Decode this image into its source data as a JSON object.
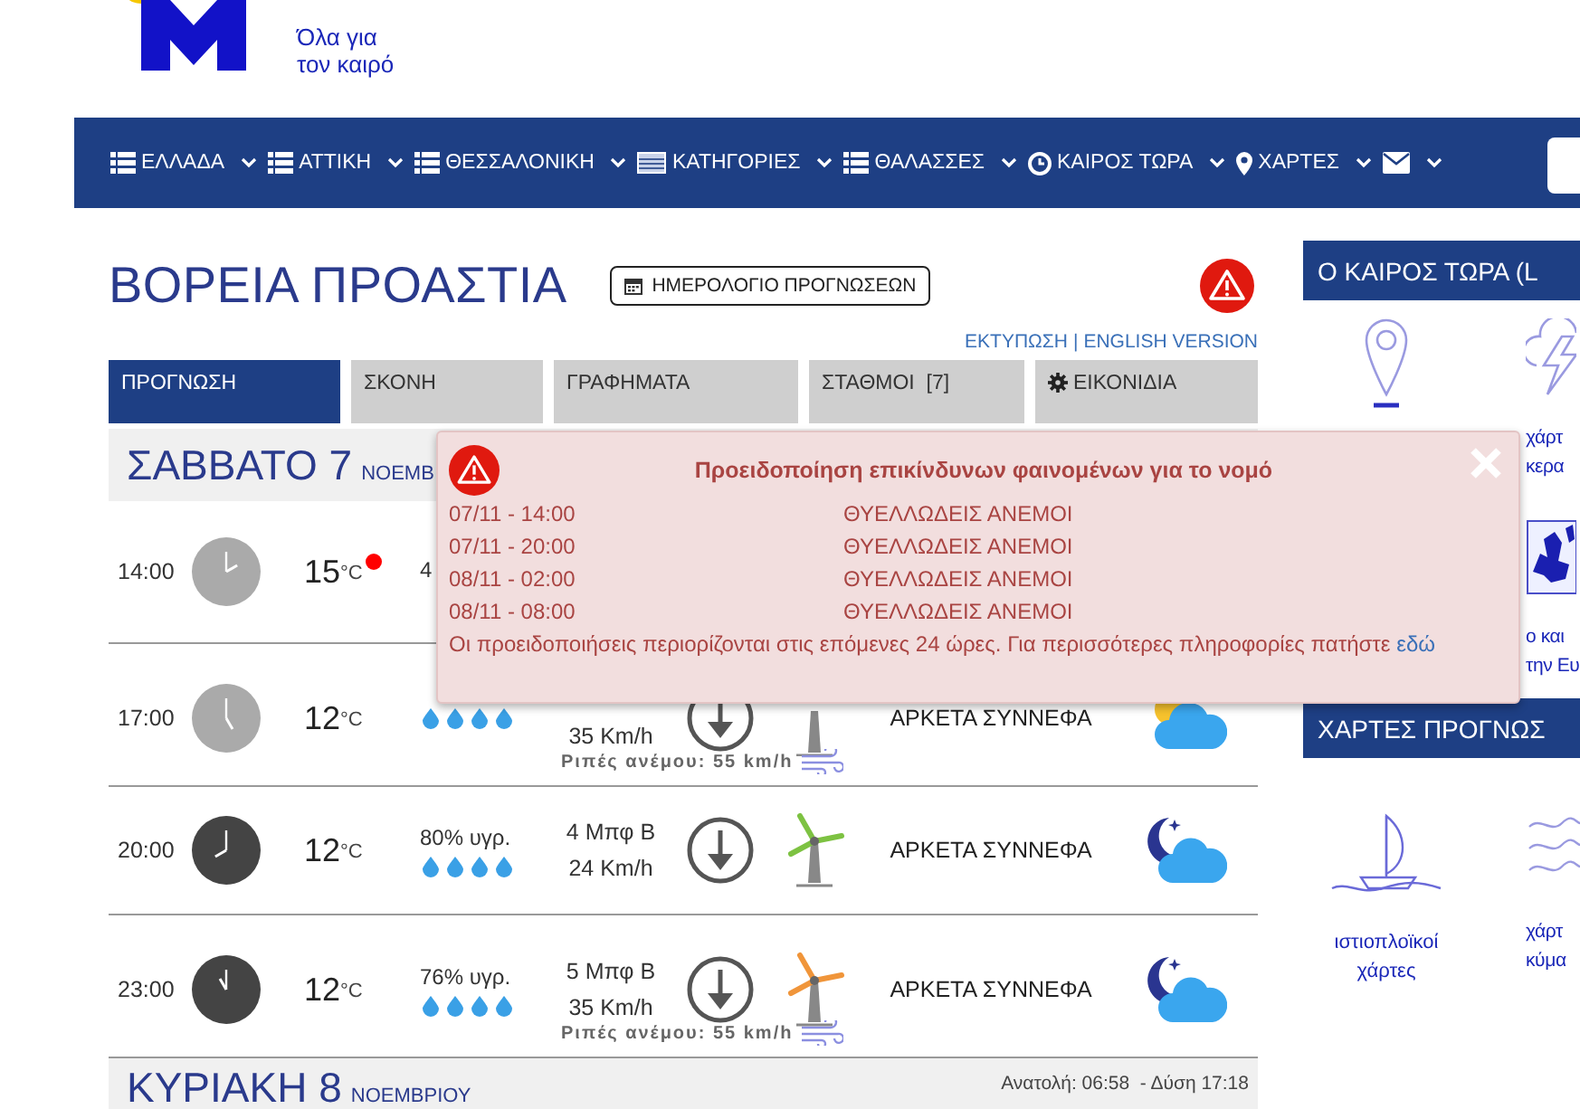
{
  "logo": {
    "tagline": [
      "Όλα για",
      "τον καιρό"
    ]
  },
  "nav": {
    "items": [
      {
        "kind": "list",
        "label": "ΕΛΛΑΔΑ"
      },
      {
        "kind": "list",
        "label": "ΑΤΤΙΚΗ"
      },
      {
        "kind": "list",
        "label": "ΘΕΣΣΑΛΟΝΙΚΗ"
      },
      {
        "kind": "table",
        "label": "ΚΑΤΗΓΟΡΙΕΣ"
      },
      {
        "kind": "list",
        "label": "ΘΑΛΑΣΣΕΣ"
      },
      {
        "kind": "clock",
        "label": "ΚΑΙΡΟΣ ΤΩΡΑ"
      },
      {
        "kind": "pin",
        "label": "ΧΑΡΤΕΣ"
      },
      {
        "kind": "mail"
      }
    ]
  },
  "page": {
    "title": "ΒΟΡΕΙΑ ΠΡΟΑΣΤΙΑ",
    "calendar_button": "ΗΜΕΡΟΛΟΓΙΟ ΠΡΟΓΝΩΣΕΩΝ",
    "links": [
      "ΕΚΤΥΠΩΣΗ",
      "ENGLISH VERSION"
    ],
    "separator": "|"
  },
  "tabs": [
    {
      "label": "ΠΡΟΓΝΩΣΗ",
      "selected": true,
      "kind": "plain"
    },
    {
      "label": "ΣΚΟΝΗ",
      "selected": false,
      "kind": "plain"
    },
    {
      "label": "ΓΡΑΦΗΜΑΤΑ",
      "selected": false,
      "kind": "plain"
    },
    {
      "label": "ΣΤΑΘΜΟΙ  [7]",
      "selected": false,
      "kind": "plain"
    },
    {
      "label": "ΕΙΚΟΝΙΔΙΑ",
      "selected": false,
      "kind": "gear"
    }
  ],
  "days": [
    {
      "name": "ΣΑΒΒΑΤΟ 7",
      "month": "ΝΟΕΜΒ",
      "rows": [
        {
          "time": "14:00",
          "night": false,
          "temp": "15",
          "unit": "°C",
          "alert": true,
          "humidity": "4"
        },
        {
          "time": "17:00",
          "night": false,
          "temp": "12",
          "unit": "°C",
          "alert": false,
          "wind_kmh": "35 Km/h",
          "description": "ΑΡΚΕΤΑ ΣΥΝΝΕΦΑ",
          "kind": "partly-cloudy-day",
          "gust": "Ριπές ανέμου: 55 km/h"
        },
        {
          "time": "20:00",
          "night": true,
          "temp": "12",
          "unit": "°C",
          "alert": false,
          "humidity": "80% υγρ.",
          "wind_bft": "4 Μπφ Β",
          "wind_kmh": "24 Km/h",
          "color": "#7dc242",
          "description": "ΑΡΚΕΤΑ ΣΥΝΝΕΦΑ",
          "kind": "cloudy-night"
        },
        {
          "time": "23:00",
          "night": true,
          "temp": "12",
          "unit": "°C",
          "alert": false,
          "humidity": "76% υγρ.",
          "wind_bft": "5 Μπφ Β",
          "wind_kmh": "35 Km/h",
          "color": "#f0953a",
          "description": "ΑΡΚΕΤΑ ΣΥΝΝΕΦΑ",
          "kind": "cloudy-night",
          "gust": "Ριπές ανέμου: 55 km/h"
        }
      ]
    },
    {
      "name": "ΚΥΡΙΑΚΗ 8",
      "month": "ΝΟΕΜΒΡΙΟΥ",
      "sun": "Ανατολή: 06:58  - Δύση 17:18"
    }
  ],
  "warning_popup": {
    "title": "Προειδοποίηση επικίνδυνων φαινομένων για το νομό",
    "warnings": [
      {
        "time": "07/11 - 14:00",
        "event": "ΘΥΕΛΛΩΔΕΙΣ ΑΝΕΜΟΙ"
      },
      {
        "time": "07/11 - 20:00",
        "event": "ΘΥΕΛΛΩΔΕΙΣ ΑΝΕΜΟΙ"
      },
      {
        "time": "08/11 - 02:00",
        "event": "ΘΥΕΛΛΩΔΕΙΣ ΑΝΕΜΟΙ"
      },
      {
        "time": "08/11 - 08:00",
        "event": "ΘΥΕΛΛΩΔΕΙΣ ΑΝΕΜΟΙ"
      }
    ],
    "note": "Οι προειδοποιήσεις περιορίζονται στις επόμενες 24 ώρες. Για περισσότερες πληροφορίες πατήστε",
    "link": "εδώ"
  },
  "sidebar": {
    "sections": [
      {
        "title": "Ο ΚΑΙΡΟΣ ΤΩΡΑ (L",
        "columns": [
          [
            {
              "kind": "pin"
            }
          ],
          [
            {
              "kind": "lightning",
              "lines": [
                "χάρτ",
                "κερα"
              ]
            },
            {
              "kind": "europe-map",
              "lines": [
                "ο και",
                "την Ευ"
              ]
            }
          ]
        ]
      },
      {
        "title": "ΧΑΡΤΕΣ ΠΡΟΓΝΩΣ",
        "columns": [
          [
            {
              "kind": "sailboat",
              "lines": [
                "ιστιοπλοϊκοί",
                "χάρτες"
              ]
            }
          ],
          [
            {
              "kind": "waves",
              "lines": [
                "χάρτ",
                "κύμα"
              ]
            }
          ]
        ]
      }
    ]
  }
}
